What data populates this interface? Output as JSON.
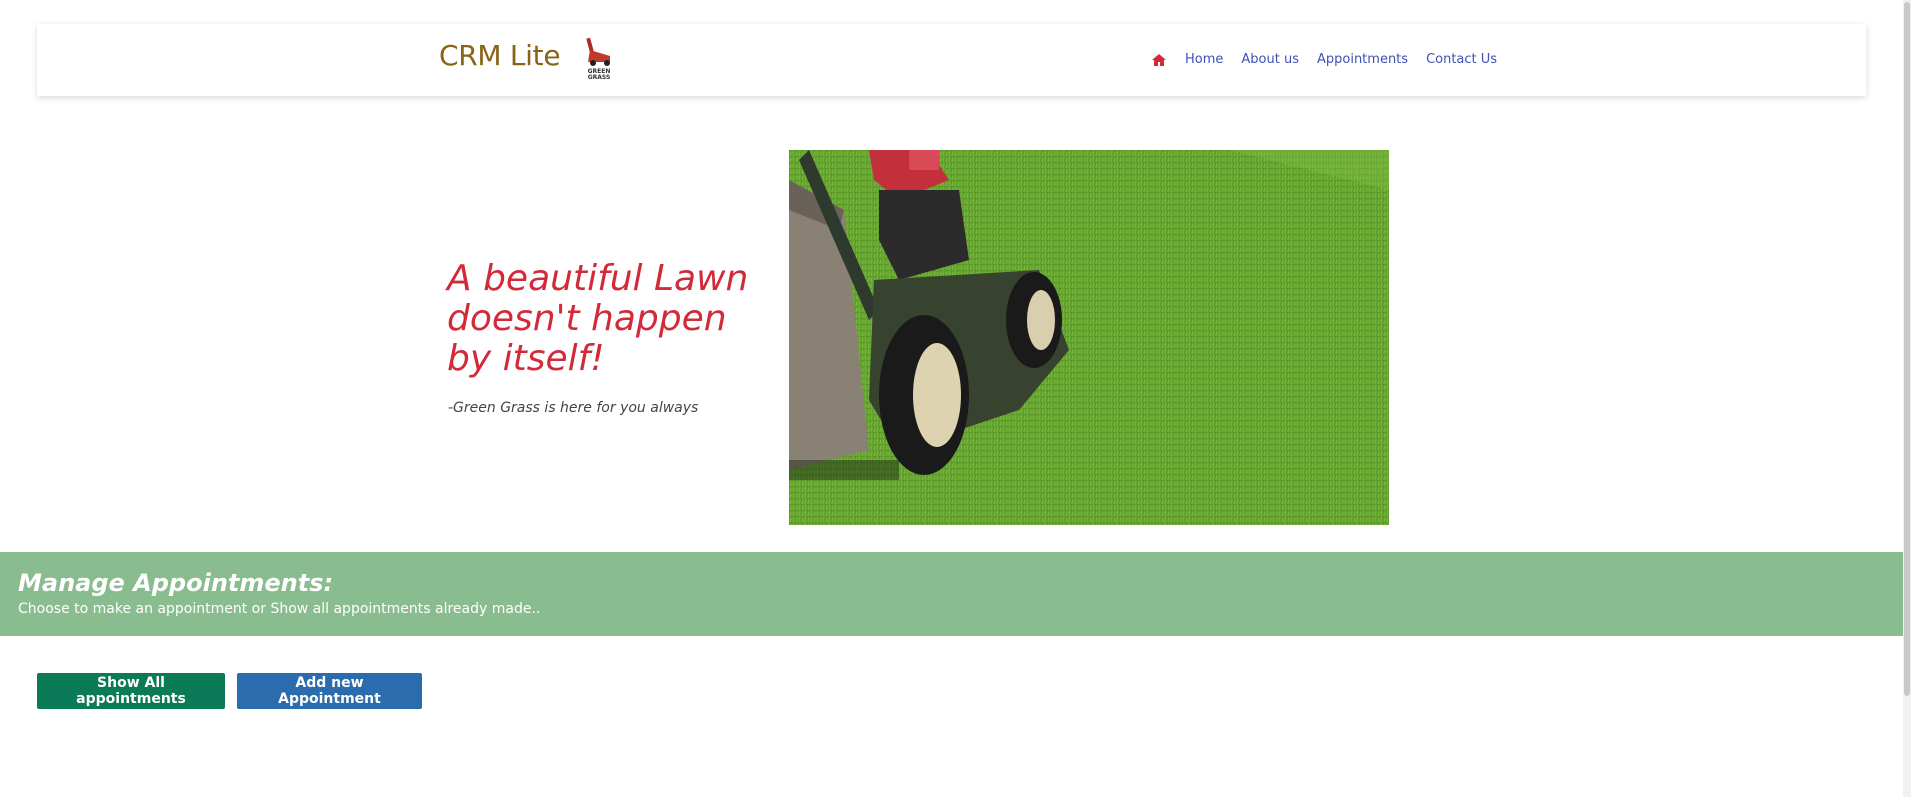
{
  "header": {
    "brand": "CRM Lite",
    "logo_text_1": "GREEN",
    "logo_text_2": "GRASS",
    "nav": {
      "home_icon": "home-icon",
      "home": "Home",
      "about": "About us",
      "appointments": "Appointments",
      "contact": "Contact Us"
    }
  },
  "hero": {
    "title": "A beautiful Lawn doesn't happen by itself!",
    "subtitle": "-Green Grass is here for you always",
    "image_icon": "lawnmower-image"
  },
  "manage": {
    "title": "Manage Appointments:",
    "subtitle": "Choose to make an appointment or Show all appointments already made.."
  },
  "actions": {
    "show_all": "Show All appointments",
    "add_new": "Add new Appointment"
  },
  "colors": {
    "brand": "#8a6414",
    "nav_link": "#3f51b5",
    "accent_red": "#d32a3a",
    "band": "#89bc8f",
    "btn_show": "#0b7a56",
    "btn_add": "#2a6cad"
  }
}
